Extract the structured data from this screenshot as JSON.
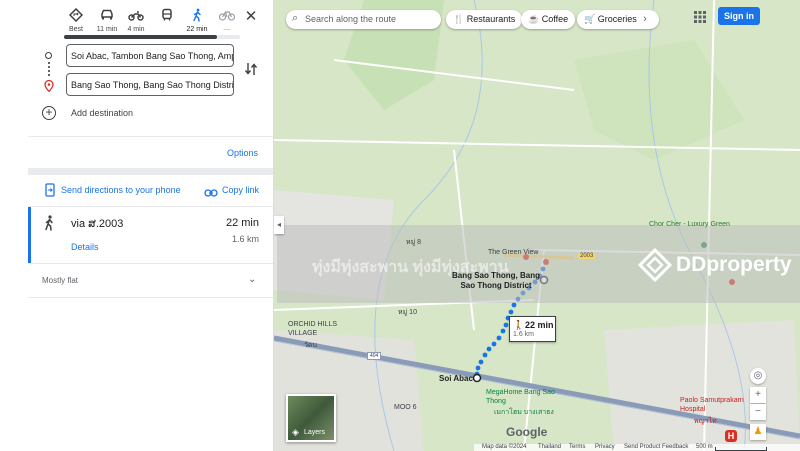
{
  "travel_modes": [
    {
      "name": "best",
      "label": "Best",
      "icon": "diamond-route-icon",
      "active": false
    },
    {
      "name": "car",
      "label": "11 min",
      "icon": "car-icon",
      "active": false
    },
    {
      "name": "motorcycle",
      "label": "4 min",
      "icon": "motorcycle-icon",
      "active": false
    },
    {
      "name": "transit",
      "label": "",
      "icon": "train-icon",
      "active": false
    },
    {
      "name": "walk",
      "label": "22 min",
      "icon": "walking-icon",
      "active": true
    },
    {
      "name": "bicycle",
      "label": "—",
      "icon": "bicycle-icon",
      "active": false
    }
  ],
  "route": {
    "origin": "Soi Abac, Tambon Bang Sao Thong, Amphoe",
    "destination": "Bang Sao Thong, Bang Sao Thong District,",
    "add_destination": "Add destination",
    "options": "Options"
  },
  "share": {
    "send_to_phone": "Send directions to your phone",
    "copy_link": "Copy link"
  },
  "result": {
    "via": "via ສ.2003",
    "duration": "22 min",
    "distance": "1.6 km",
    "details": "Details",
    "terrain": "Mostly flat"
  },
  "map": {
    "search_placeholder": "Search along the route",
    "chips": [
      "Restaurants",
      "Coffee",
      "Groceries"
    ],
    "sign_in": "Sign in",
    "accent": "#1a73e8",
    "labels": {
      "chor_cher": "Chor Cher - Luxury Green",
      "green_view": "The Green View",
      "destination": "Bang Sao Thong, Bang Sao Thong District",
      "orchid_hills": "ORCHID HILLS VILLAGE",
      "moo8": "หมู่ 8",
      "moo10": "หมู่ 10",
      "moo6": "MOO 6",
      "soi_abac": "Soi Abac",
      "megahome": "MegaHome Bang Sao Thong",
      "hospital": "Paolo Samutprakarn Hospital",
      "road_2003": "2003",
      "road_404": "404",
      "thai_small": "วัดบ",
      "thai_home": "เมกาโฮม บางเสาธง",
      "thai_hospital": "พญาไท"
    },
    "route_badge": {
      "time": "22 min",
      "dist": "1.6 km"
    },
    "layers": "Layers",
    "watermark": "DDproperty",
    "watermark_thai": "ทุ่งมีทุ่งสะพาน ทุ่งมีทุ่งสะพาน",
    "google": "Google",
    "footer": [
      "Map data ©2024",
      "Thailand",
      "Terms",
      "Privacy",
      "Send Product Feedback",
      "500 m"
    ]
  }
}
